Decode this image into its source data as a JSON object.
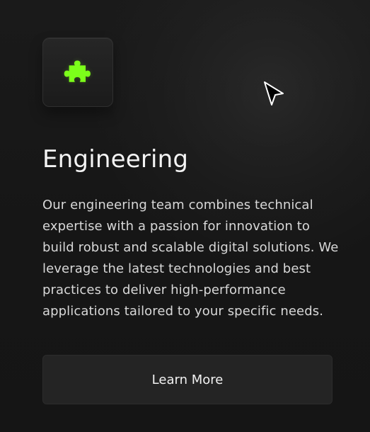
{
  "card": {
    "icon": "puzzle-piece-icon",
    "icon_color": "#7CFF1A",
    "title": "Engineering",
    "description": "Our engineering team combines technical expertise with a passion for innovation to build robust and scalable digital solutions. We leverage the latest technologies and best practices to deliver high-performance applications tailored to your specific needs.",
    "button_label": "Learn More"
  },
  "pointer": {
    "icon": "mouse-pointer-icon"
  }
}
